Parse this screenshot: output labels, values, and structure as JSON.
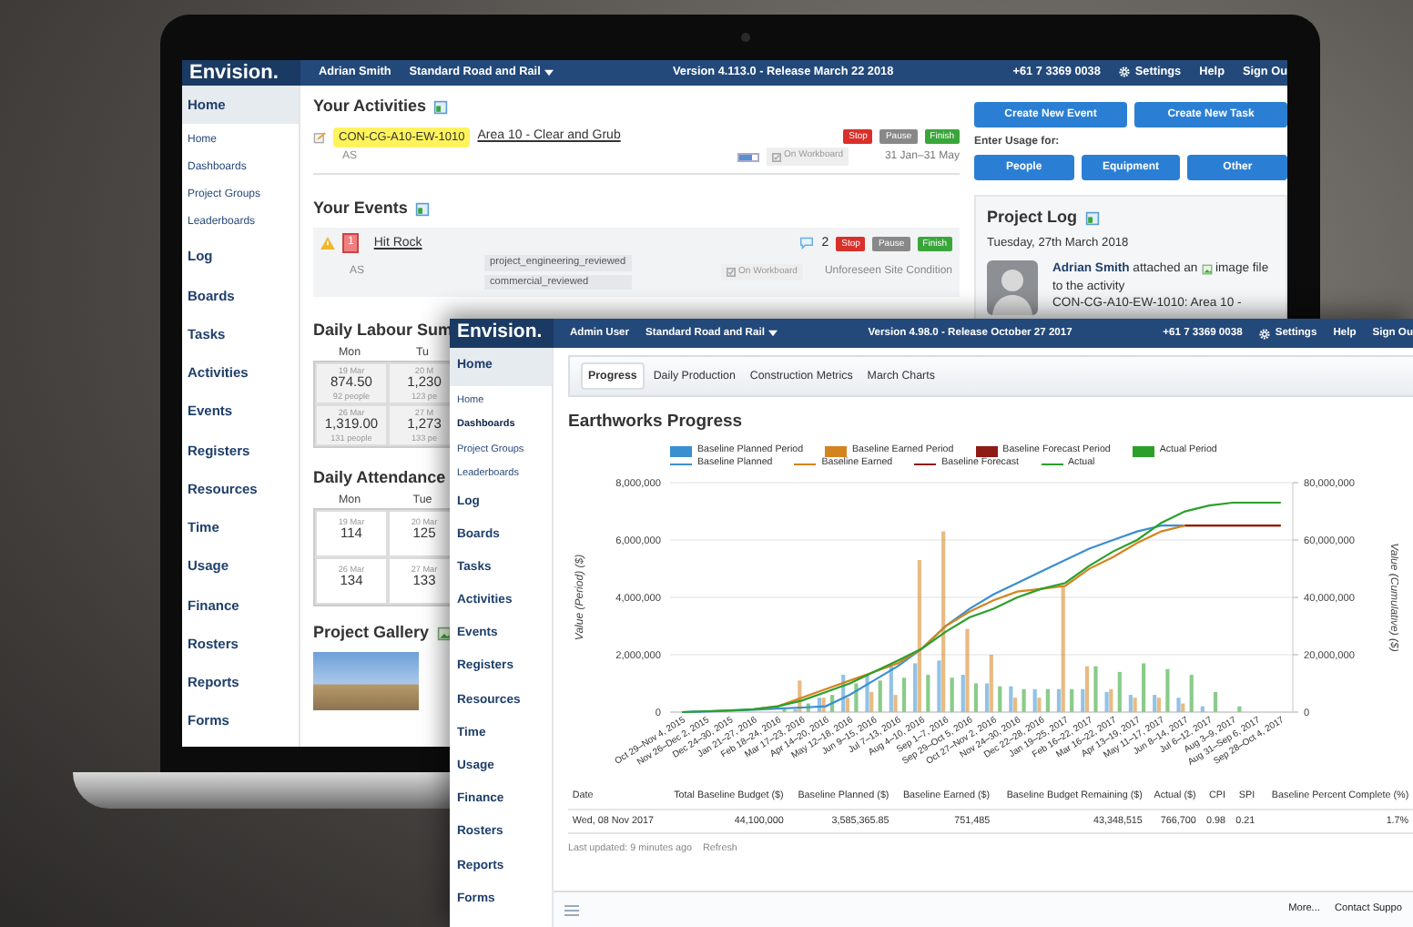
{
  "back_window": {
    "topbar": {
      "logo": "Envision.",
      "user": "Adrian Smith",
      "project": "Standard Road and Rail",
      "version": "Version 4.113.0 - Release March 22 2018",
      "phone": "+61 7 3369 0038",
      "links": [
        {
          "label": "Settings",
          "kind": "settings"
        },
        {
          "label": "Help",
          "kind": "plain"
        },
        {
          "label": "Sign Ou",
          "kind": "plain"
        }
      ]
    },
    "sidebar": {
      "items": [
        {
          "label": "Home",
          "kind": "header"
        },
        {
          "label": "Home",
          "kind": "sub"
        },
        {
          "label": "Dashboards",
          "kind": "sub"
        },
        {
          "label": "Project Groups",
          "kind": "sub"
        },
        {
          "label": "Leaderboards",
          "kind": "sub"
        },
        {
          "label": "Log",
          "kind": "section"
        },
        {
          "label": "Boards",
          "kind": "section"
        },
        {
          "label": "Tasks",
          "kind": "section"
        },
        {
          "label": "Activities",
          "kind": "section"
        },
        {
          "label": "Events",
          "kind": "section"
        },
        {
          "label": "Registers",
          "kind": "section"
        },
        {
          "label": "Resources",
          "kind": "section"
        },
        {
          "label": "Time",
          "kind": "section"
        },
        {
          "label": "Usage",
          "kind": "section"
        },
        {
          "label": "Finance",
          "kind": "section"
        },
        {
          "label": "Rosters",
          "kind": "section"
        },
        {
          "label": "Reports",
          "kind": "section"
        },
        {
          "label": "Forms",
          "kind": "section"
        }
      ]
    },
    "activities": {
      "title": "Your Activities",
      "items": [
        {
          "code": "CON-CG-A10-EW-1010",
          "name": "Area 10 - Clear and Grub",
          "user": "AS",
          "level": 0.7,
          "workboard": "On Workboard",
          "dates": "31 Jan–31 May",
          "buttons": [
            {
              "label": "Stop",
              "kind": "stop"
            },
            {
              "label": "Pause",
              "kind": "pause"
            },
            {
              "label": "Finish",
              "kind": "finish"
            }
          ]
        }
      ]
    },
    "events": {
      "title": "Your Events",
      "items": [
        {
          "count": "1",
          "name": "Hit Rock",
          "comments": "2",
          "user": "AS",
          "tags": [
            "project_engineering_reviewed",
            "commercial_reviewed"
          ],
          "workboard": "On Workboard",
          "category": "Unforeseen Site Condition",
          "buttons": [
            {
              "label": "Stop",
              "kind": "stop"
            },
            {
              "label": "Pause",
              "kind": "pause"
            },
            {
              "label": "Finish",
              "kind": "finish"
            }
          ]
        }
      ]
    },
    "labour": {
      "title": "Daily Labour Sum",
      "headers": [
        "Mon",
        "Tu"
      ],
      "rows": [
        [
          {
            "date": "19 Mar",
            "value": "874.50",
            "people": "92 people"
          },
          {
            "date": "20 M",
            "value": "1,230",
            "people": "123 pe"
          }
        ],
        [
          {
            "date": "26 Mar",
            "value": "1,319.00",
            "people": "131 people"
          },
          {
            "date": "27 M",
            "value": "1,273",
            "people": "133 pe"
          }
        ]
      ]
    },
    "attendance": {
      "title": "Daily Attendance",
      "headers": [
        "Mon",
        "Tue"
      ],
      "rows": [
        [
          {
            "date": "19 Mar",
            "value": "114"
          },
          {
            "date": "20 Mar",
            "value": "125"
          }
        ],
        [
          {
            "date": "26 Mar",
            "value": "134"
          },
          {
            "date": "27 Mar",
            "value": "133"
          }
        ]
      ]
    },
    "gallery": {
      "title": "Project Gallery"
    },
    "actions": {
      "buttons": [
        "Create New Event",
        "Create New Task"
      ],
      "usage_label": "Enter Usage for:",
      "usage_buttons": [
        "People",
        "Equipment",
        "Other"
      ]
    },
    "project_log": {
      "title": "Project Log",
      "date": "Tuesday, 27th March 2018",
      "entry": {
        "text": "**Adrian Smith** attached an",
        "link": "image",
        "text2": "file to the activity",
        "link2": "CON-CG-A10-EW-1010: Area 10 -"
      }
    }
  },
  "front_window": {
    "topbar": {
      "logo": "Envision.",
      "user": "Admin User",
      "project": "Standard Road and Rail",
      "version": "Version 4.98.0 - Release October 27 2017",
      "phone": "+61 7 3369 0038",
      "links": [
        {
          "label": "Settings",
          "kind": "settings"
        },
        {
          "label": "Help",
          "kind": "plain"
        },
        {
          "label": "Sign Ou",
          "kind": "plain"
        }
      ]
    },
    "sidebar": {
      "items": [
        {
          "label": "Home",
          "kind": "header",
          "selected": false
        },
        {
          "label": "Home",
          "kind": "sub",
          "selected": false
        },
        {
          "label": "Dashboards",
          "kind": "sub",
          "selected": true
        },
        {
          "label": "Project Groups",
          "kind": "sub",
          "selected": false
        },
        {
          "label": "Leaderboards",
          "kind": "sub",
          "selected": false
        },
        {
          "label": "Log",
          "kind": "section",
          "selected": false
        },
        {
          "label": "Boards",
          "kind": "section",
          "selected": false
        },
        {
          "label": "Tasks",
          "kind": "section",
          "selected": false
        },
        {
          "label": "Activities",
          "kind": "section",
          "selected": false
        },
        {
          "label": "Events",
          "kind": "section",
          "selected": false
        },
        {
          "label": "Registers",
          "kind": "section",
          "selected": false
        },
        {
          "label": "Resources",
          "kind": "section",
          "selected": false
        },
        {
          "label": "Time",
          "kind": "section",
          "selected": false
        },
        {
          "label": "Usage",
          "kind": "section",
          "selected": false
        },
        {
          "label": "Finance",
          "kind": "section",
          "selected": false
        },
        {
          "label": "Rosters",
          "kind": "section",
          "selected": false
        },
        {
          "label": "Reports",
          "kind": "section",
          "selected": false
        },
        {
          "label": "Forms",
          "kind": "section",
          "selected": false
        }
      ]
    },
    "tabs": [
      {
        "label": "Progress",
        "selected": true
      },
      {
        "label": "Daily Production",
        "selected": false
      },
      {
        "label": "Construction Metrics",
        "selected": false
      },
      {
        "label": "March Charts",
        "selected": false
      }
    ],
    "title": "Earthworks Progress",
    "period_chart": {
      "chart_data": {
        "type": "bar",
        "ylabel": "Value (Period) ($)",
        "grid": true,
        "categories": [
          "Oct 29–Nov 4, 2015",
          "Nov 26–Dec 2, 2015",
          "Dec 24–30, 2015",
          "Jan 21–27, 2016",
          "Feb 18–24, 2016",
          "Mar 17–23, 2016",
          "Apr 14–20, 2016",
          "May 12–18, 2016",
          "Jun 9–15, 2016",
          "Jul 7–13, 2016",
          "Aug 4–10, 2016",
          "Sep 1–7, 2016",
          "Sep 29–Oct 5, 2016",
          "Oct 27–Nov 2, 2016",
          "Nov 24–30, 2016",
          "Dec 22–28, 2016",
          "Jan 19–25, 2017",
          "Feb 16–22, 2017",
          "Mar 16–22, 2017",
          "Apr 13–19, 2017",
          "May 11–17, 2017",
          "Jun 8–14, 2017",
          "Jul 6–12, 2017",
          "Aug 3–9, 2017",
          "Aug 31–Sep 6, 2017",
          "Sep 28–Oct 4, 2017"
        ],
        "ylim": [
          0,
          8000000
        ],
        "yticks": [
          {
            "value": 0,
            "label": "0"
          },
          {
            "value": 2000000,
            "label": "2,000,000"
          },
          {
            "value": 4000000,
            "label": "4,000,000"
          },
          {
            "value": 6000000,
            "label": "6,000,000"
          },
          {
            "value": 8000000,
            "label": "8,000,000"
          }
        ],
        "series": [
          {
            "name": "Baseline Planned Period",
            "color": "#3a8fd0",
            "values": [
              0,
              0,
              0,
              0,
              0,
              100000,
              500000,
              1300000,
              1300000,
              1600000,
              1700000,
              1800000,
              1300000,
              1000000,
              900000,
              800000,
              800000,
              800000,
              700000,
              600000,
              600000,
              500000,
              200000,
              0,
              0,
              0
            ]
          },
          {
            "name": "Baseline Earned Period",
            "color": "#d4841e",
            "values": [
              0,
              0,
              0,
              0,
              0,
              1100000,
              500000,
              500000,
              700000,
              600000,
              5300000,
              6300000,
              2900000,
              2000000,
              500000,
              500000,
              4400000,
              1600000,
              800000,
              500000,
              500000,
              300000,
              0,
              0,
              0,
              0
            ]
          },
          {
            "name": "Baseline Forecast Period",
            "color": "#8e1b14",
            "values": [
              null,
              null,
              null,
              null,
              null,
              null,
              null,
              null,
              null,
              null,
              null,
              null,
              null,
              null,
              null,
              null,
              null,
              null,
              null,
              null,
              null,
              null,
              null,
              null,
              null,
              null
            ]
          },
          {
            "name": "Actual Period",
            "color": "#2aa02a",
            "values": [
              0,
              0,
              0,
              0,
              100000,
              300000,
              600000,
              1000000,
              1100000,
              1200000,
              1300000,
              1200000,
              1000000,
              900000,
              800000,
              800000,
              800000,
              1600000,
              1400000,
              1700000,
              1500000,
              1300000,
              700000,
              200000,
              0,
              0
            ]
          }
        ]
      }
    },
    "cumulative_chart": {
      "chart_data": {
        "type": "line",
        "ylabel": "Value (Cumulative) ($)",
        "ylim": [
          0,
          80000000
        ],
        "yticks": [
          {
            "value": 0,
            "label": "0"
          },
          {
            "value": 20000000,
            "label": "20,000,000"
          },
          {
            "value": 40000000,
            "label": "40,000,000"
          },
          {
            "value": 60000000,
            "label": "60,000,000"
          },
          {
            "value": 80000000,
            "label": "80,000,000"
          }
        ],
        "series": [
          {
            "name": "Baseline Planned",
            "color": "#3a8fd0",
            "values": [
              0,
              200000,
              500000,
              800000,
              1200000,
              1600000,
              2000000,
              6000000,
              11000000,
              16000000,
              22000000,
              30000000,
              36000000,
              41000000,
              45000000,
              49000000,
              53000000,
              57000000,
              60000000,
              63000000,
              65000000,
              65000000,
              null,
              null,
              null,
              null
            ]
          },
          {
            "name": "Baseline Earned",
            "color": "#d4841e",
            "values": [
              null,
              null,
              null,
              1000000,
              2000000,
              5000000,
              8000000,
              11000000,
              14000000,
              17000000,
              22000000,
              30000000,
              35000000,
              39000000,
              42000000,
              43000000,
              44000000,
              50000000,
              54000000,
              59000000,
              63000000,
              65000000,
              65000000,
              65000000,
              65000000,
              65000000
            ]
          },
          {
            "name": "Baseline Forecast",
            "color": "#8e1b14",
            "values": [
              null,
              null,
              null,
              null,
              null,
              null,
              null,
              null,
              null,
              null,
              null,
              null,
              null,
              null,
              null,
              null,
              null,
              null,
              null,
              null,
              null,
              65000000,
              65000000,
              65000000,
              65000000,
              65000000
            ]
          },
          {
            "name": "Actual",
            "color": "#2aa02a",
            "values": [
              0,
              300000,
              600000,
              1000000,
              2000000,
              4000000,
              7000000,
              10000000,
              14000000,
              18000000,
              22000000,
              28000000,
              33000000,
              36000000,
              40000000,
              43000000,
              45000000,
              51000000,
              56000000,
              60000000,
              66000000,
              70000000,
              72000000,
              73000000,
              73000000,
              73000000
            ]
          }
        ]
      }
    },
    "table": {
      "columns": [
        "Date",
        "Total Baseline Budget ($)",
        "Baseline Planned ($)",
        "Baseline Earned ($)",
        "Baseline Budget Remaining ($)",
        "Actual ($)",
        "CPI",
        "SPI",
        "Baseline Percent Complete (%)"
      ],
      "rows": [
        [
          "Wed, 08 Nov 2017",
          "44,100,000",
          "3,585,365.85",
          "751,485",
          "43,348,515",
          "766,700",
          "0.98",
          "0.21",
          "1.7%"
        ]
      ]
    },
    "updated": "Last updated: 9 minutes ago",
    "refresh": "Refresh",
    "footer": {
      "links": [
        "More...",
        "Contact Suppo"
      ]
    }
  }
}
